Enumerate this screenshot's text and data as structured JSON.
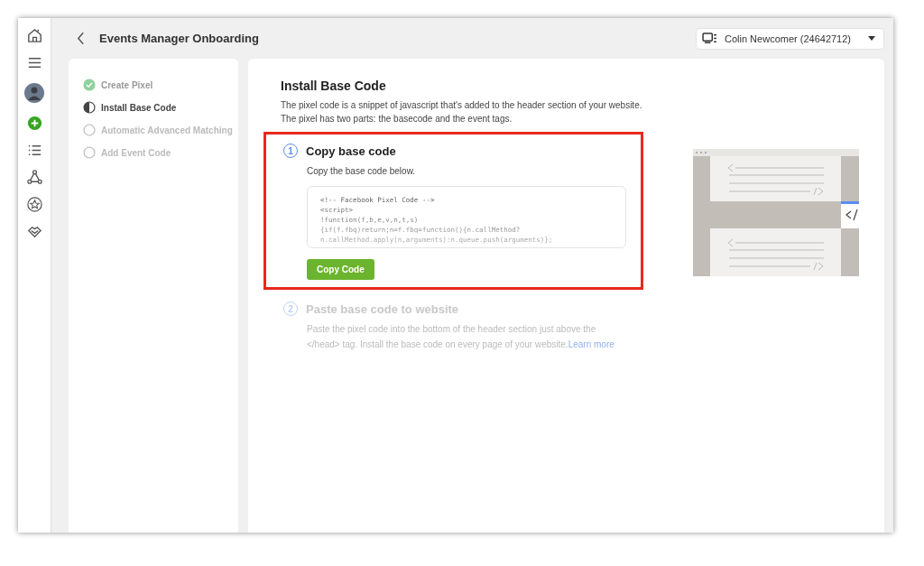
{
  "header": {
    "title": "Events Manager Onboarding",
    "account": "Colin Newcomer (24642712)"
  },
  "steps": [
    {
      "label": "Create Pixel",
      "kind": "done"
    },
    {
      "label": "Install Base Code",
      "kind": "current"
    },
    {
      "label": "Automatic Advanced Matching",
      "kind": "pending"
    },
    {
      "label": "Add Event Code",
      "kind": "pending"
    }
  ],
  "main": {
    "title": "Install Base Code",
    "intro": [
      "The pixel code is a snippet of javascript that's added to the header section of your website.",
      "The pixel has two parts: the basecode and the event tags."
    ],
    "sections": [
      {
        "number": "1",
        "title": "Copy base code",
        "active": true,
        "highlighted": true,
        "text": "Copy the base code below.",
        "code": [
          "<!-- Facebook Pixel Code -->",
          "<script>",
          "!function(f,b,e,v,n,t,s)",
          "{if(f.fbq)return;n=f.fbq=function(){n.callMethod?",
          "n.callMethod.apply(n,arguments):n.queue.push(arguments)};"
        ],
        "button": "Copy Code"
      },
      {
        "number": "2",
        "title": "Paste base code to website",
        "active": false,
        "highlighted": false,
        "text": "Paste the pixel code into the bottom of the header section just above the </head> tag. Install the base code on every page of your website.",
        "link": "Learn more"
      }
    ]
  }
}
